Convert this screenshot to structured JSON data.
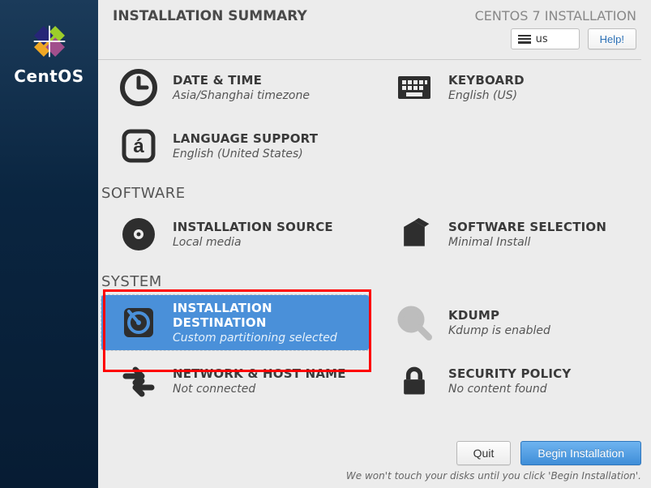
{
  "brand": "CentOS",
  "header": {
    "title": "INSTALLATION SUMMARY",
    "product": "CENTOS 7 INSTALLATION",
    "keyboard_layout": "us",
    "help_label": "Help!"
  },
  "categories": {
    "localization": {
      "datetime": {
        "title": "DATE & TIME",
        "status": "Asia/Shanghai timezone"
      },
      "keyboard": {
        "title": "KEYBOARD",
        "status": "English (US)"
      },
      "language": {
        "title": "LANGUAGE SUPPORT",
        "status": "English (United States)"
      }
    },
    "software": {
      "label": "SOFTWARE",
      "source": {
        "title": "INSTALLATION SOURCE",
        "status": "Local media"
      },
      "selection": {
        "title": "SOFTWARE SELECTION",
        "status": "Minimal Install"
      }
    },
    "system": {
      "label": "SYSTEM",
      "destination": {
        "title": "INSTALLATION DESTINATION",
        "status": "Custom partitioning selected"
      },
      "kdump": {
        "title": "KDUMP",
        "status": "Kdump is enabled"
      },
      "network": {
        "title": "NETWORK & HOST NAME",
        "status": "Not connected"
      },
      "security": {
        "title": "SECURITY POLICY",
        "status": "No content found"
      }
    }
  },
  "footer": {
    "quit": "Quit",
    "begin": "Begin Installation",
    "hint": "We won't touch your disks until you click 'Begin Installation'."
  }
}
